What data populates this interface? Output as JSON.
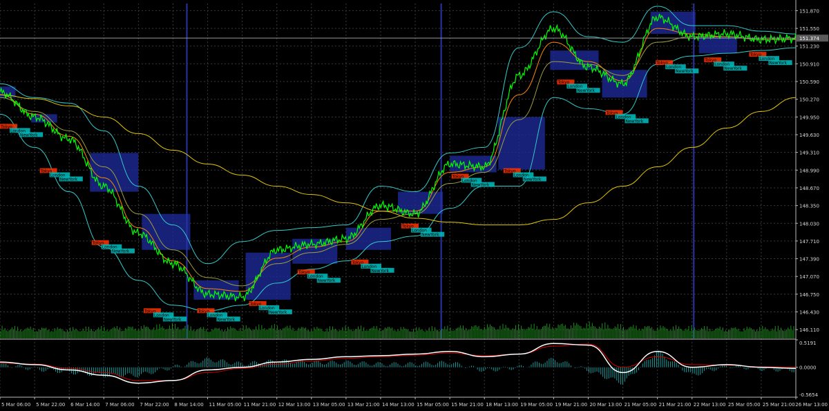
{
  "colors": {
    "background": "#000000",
    "grid": "#3a3a3a",
    "axis_text": "#d8d8d8",
    "price_line_bull": "#00ff00",
    "price_line_bear": "#2f8f2f",
    "bollinger": "#33cccc",
    "ma_fast": "#ff8800",
    "ma_mid": "#a0a040",
    "ma_slow": "#e6c800",
    "session_box": "#1e2a9a",
    "session_divider": "#2833a8",
    "volume": "#1f8f1f",
    "osc_main": "#ffffff",
    "osc_signal": "#cc0000",
    "osc_hist": "#1a9a9a",
    "current_price_line": "#9a9a9a",
    "current_price_box": "#5a5a5a",
    "tokyo": "#ff3300",
    "london": "#00bfbf",
    "newyork": "#00bfbf"
  },
  "chart_data": [
    {
      "type": "line",
      "title": "",
      "xlabel": "",
      "ylabel": "",
      "ylim": [
        145.95,
        152.0
      ],
      "y_ticks": [
        "151.870",
        "151.550",
        "151.230",
        "150.910",
        "150.590",
        "150.270",
        "149.950",
        "149.630",
        "149.310",
        "148.990",
        "148.670",
        "148.350",
        "148.030",
        "147.710",
        "147.390",
        "147.070",
        "146.750",
        "146.430",
        "146.110"
      ],
      "x_ticks": [
        "5 Mar 06:00",
        "5 Mar 22:00",
        "6 Mar 14:00",
        "7 Mar 06:00",
        "7 Mar 22:00",
        "8 Mar 14:00",
        "11 Mar 05:00",
        "11 Mar 21:00",
        "12 Mar 13:00",
        "13 Mar 05:00",
        "13 Mar 21:00",
        "14 Mar 13:00",
        "15 Mar 05:00",
        "15 Mar 21:00",
        "18 Mar 13:00",
        "19 Mar 05:00",
        "19 Mar 21:00",
        "20 Mar 13:00",
        "21 Mar 05:00",
        "21 Mar 21:00",
        "22 Mar 13:00",
        "25 Mar 05:00",
        "25 Mar 21:00",
        "26 Mar 13:00"
      ],
      "current_price": "151.374",
      "grid": true,
      "series": [
        {
          "role": "price",
          "x": [
            0,
            1,
            2,
            3,
            4,
            5,
            6,
            7,
            8,
            9,
            10,
            11,
            12,
            13,
            14,
            15,
            16,
            17,
            18,
            19,
            20,
            21,
            22,
            23
          ],
          "values": [
            150.4,
            149.95,
            149.55,
            148.7,
            147.85,
            147.3,
            146.75,
            146.7,
            147.55,
            147.65,
            147.75,
            148.35,
            148.2,
            149.1,
            149.05,
            150.7,
            151.55,
            150.85,
            150.55,
            151.75,
            151.4,
            151.45,
            151.35,
            151.37
          ]
        },
        {
          "role": "bollinger-upper",
          "values": [
            150.55,
            150.3,
            150.2,
            149.7,
            148.7,
            148.0,
            147.3,
            147.7,
            147.9,
            147.95,
            148.0,
            148.7,
            148.6,
            149.3,
            149.4,
            151.2,
            151.85,
            151.4,
            151.3,
            151.95,
            151.6,
            151.6,
            151.5,
            151.45
          ]
        },
        {
          "role": "bollinger-lower",
          "values": [
            150.0,
            149.4,
            148.6,
            147.6,
            147.0,
            146.55,
            146.45,
            146.55,
            146.95,
            147.2,
            147.35,
            147.7,
            147.8,
            148.3,
            148.7,
            148.7,
            150.3,
            150.1,
            150.0,
            150.9,
            151.05,
            151.1,
            151.15,
            151.2
          ]
        },
        {
          "role": "ma-fast",
          "values": [
            150.35,
            150.0,
            149.6,
            148.85,
            147.95,
            147.35,
            146.85,
            146.8,
            147.4,
            147.6,
            147.7,
            148.25,
            148.25,
            148.95,
            149.05,
            150.35,
            151.3,
            150.95,
            150.6,
            151.55,
            151.45,
            151.4,
            151.35,
            151.35
          ]
        },
        {
          "role": "ma-mid",
          "values": [
            150.3,
            150.05,
            149.7,
            149.05,
            148.2,
            147.55,
            147.05,
            146.9,
            147.3,
            147.5,
            147.65,
            148.1,
            148.2,
            148.75,
            148.95,
            149.9,
            150.95,
            150.9,
            150.7,
            151.3,
            151.4,
            151.4,
            151.35,
            151.35
          ]
        },
        {
          "role": "ma-slow",
          "values": [
            150.35,
            150.28,
            150.15,
            149.95,
            149.65,
            149.35,
            149.1,
            148.9,
            148.7,
            148.55,
            148.4,
            148.25,
            148.12,
            148.05,
            148.0,
            148.0,
            148.1,
            148.4,
            148.7,
            149.05,
            149.4,
            149.75,
            150.05,
            150.3
          ]
        }
      ],
      "volume": [
        0.34,
        0.32,
        0.3,
        0.33,
        0.36,
        0.4,
        0.3,
        0.35,
        0.38,
        0.32,
        0.33,
        0.35,
        0.3,
        0.34,
        0.4,
        0.37,
        0.42,
        0.45,
        0.38,
        0.36,
        0.34,
        0.32,
        0.33,
        0.34
      ],
      "session_boxes": [
        {
          "t0": 0.0,
          "t1": 0.45,
          "hi": 150.5,
          "lo": 150.3
        },
        {
          "t0": 0.9,
          "t1": 1.65,
          "hi": 150.0,
          "lo": 149.85
        },
        {
          "t0": 2.6,
          "t1": 4.0,
          "hi": 149.3,
          "lo": 148.6
        },
        {
          "t0": 4.1,
          "t1": 5.5,
          "hi": 148.2,
          "lo": 147.55
        },
        {
          "t0": 5.6,
          "t1": 6.9,
          "hi": 147.0,
          "lo": 146.65
        },
        {
          "t0": 7.1,
          "t1": 8.4,
          "hi": 147.5,
          "lo": 146.65
        },
        {
          "t0": 8.45,
          "t1": 9.75,
          "hi": 147.75,
          "lo": 147.3
        },
        {
          "t0": 10.0,
          "t1": 11.3,
          "hi": 147.95,
          "lo": 147.55
        },
        {
          "t0": 11.5,
          "t1": 12.8,
          "hi": 148.6,
          "lo": 148.2
        },
        {
          "t0": 13.0,
          "t1": 14.35,
          "hi": 149.25,
          "lo": 148.95
        },
        {
          "t0": 14.4,
          "t1": 15.75,
          "hi": 149.95,
          "lo": 149.0
        },
        {
          "t0": 15.9,
          "t1": 17.3,
          "hi": 151.15,
          "lo": 150.8
        },
        {
          "t0": 17.4,
          "t1": 18.7,
          "hi": 150.8,
          "lo": 150.3
        },
        {
          "t0": 18.8,
          "t1": 20.1,
          "hi": 151.85,
          "lo": 151.45
        },
        {
          "t0": 20.2,
          "t1": 21.3,
          "hi": 151.4,
          "lo": 151.1
        }
      ],
      "session_dividers": [
        5.4,
        12.75,
        20.05
      ],
      "session_labels": {
        "tokyo": "Tokyo",
        "london": "London",
        "newyork": "NewYork",
        "anchors": [
          {
            "t": 0.0,
            "p": 149.75
          },
          {
            "t": 1.15,
            "p": 148.95
          },
          {
            "t": 2.65,
            "p": 147.65
          },
          {
            "t": 4.15,
            "p": 146.42
          },
          {
            "t": 5.7,
            "p": 146.42
          },
          {
            "t": 7.2,
            "p": 146.55
          },
          {
            "t": 8.6,
            "p": 147.12
          },
          {
            "t": 10.15,
            "p": 147.3
          },
          {
            "t": 11.6,
            "p": 147.95
          },
          {
            "t": 13.05,
            "p": 148.85
          },
          {
            "t": 14.55,
            "p": 148.95
          },
          {
            "t": 16.1,
            "p": 150.55
          },
          {
            "t": 17.5,
            "p": 150.0
          },
          {
            "t": 18.95,
            "p": 150.9
          },
          {
            "t": 20.35,
            "p": 150.95
          },
          {
            "t": 21.65,
            "p": 151.05
          }
        ]
      }
    },
    {
      "type": "line",
      "title": "",
      "ylim": [
        -0.5654,
        0.5191
      ],
      "y_ticks": [
        "0.5191",
        "0.0000",
        "-0.5654"
      ],
      "series": [
        {
          "role": "oscillator-main",
          "values": [
            0.1,
            0.05,
            -0.05,
            -0.15,
            -0.3,
            -0.25,
            -0.05,
            0.0,
            0.1,
            0.15,
            0.2,
            0.22,
            0.25,
            0.3,
            0.2,
            0.25,
            0.45,
            0.42,
            -0.1,
            0.3,
            0.0,
            0.05,
            0.0,
            -0.02
          ]
        },
        {
          "role": "oscillator-signal",
          "values": [
            0.08,
            0.06,
            -0.02,
            -0.1,
            -0.25,
            -0.25,
            -0.1,
            -0.02,
            0.06,
            0.12,
            0.17,
            0.2,
            0.23,
            0.27,
            0.22,
            0.25,
            0.4,
            0.44,
            0.0,
            0.2,
            0.05,
            0.04,
            0.01,
            0.0
          ]
        }
      ]
    }
  ]
}
